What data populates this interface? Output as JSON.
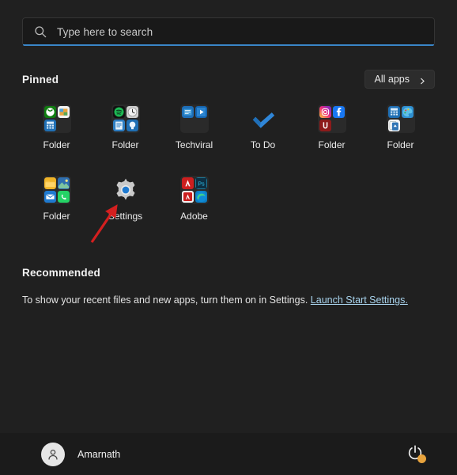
{
  "search": {
    "placeholder": "Type here to search",
    "icon": "search-icon",
    "accent_color": "#3a86c8"
  },
  "pinned": {
    "title": "Pinned",
    "all_apps_label": "All apps",
    "all_apps_icon": "chevron-right-icon",
    "items": [
      {
        "label": "Folder",
        "type": "folder",
        "icons": [
          "xbox-icon",
          "store-icon",
          "calculator-icon"
        ]
      },
      {
        "label": "Folder",
        "type": "folder",
        "icons": [
          "spotify-icon",
          "clock-icon",
          "notepad-icon",
          "tips-icon"
        ]
      },
      {
        "label": "Techviral",
        "type": "folder",
        "icons": [
          "news-icon",
          "video-icon"
        ]
      },
      {
        "label": "To Do",
        "type": "app",
        "icon": "todo-checkmark-icon"
      },
      {
        "label": "Folder",
        "type": "folder",
        "icons": [
          "instagram-icon",
          "facebook-icon",
          "uc-browser-icon"
        ]
      },
      {
        "label": "Folder",
        "type": "folder",
        "icons": [
          "calculator-icon",
          "paint-icon",
          "solitaire-icon"
        ]
      },
      {
        "label": "Folder",
        "type": "folder",
        "icons": [
          "file-explorer-icon",
          "photos-icon",
          "mail-icon",
          "whatsapp-icon"
        ]
      },
      {
        "label": "Settings",
        "type": "app",
        "icon": "gear-icon"
      },
      {
        "label": "Adobe",
        "type": "folder",
        "icons": [
          "acrobat-icon",
          "photoshop-icon",
          "adobe-red-icon",
          "edge-icon"
        ]
      }
    ]
  },
  "recommended": {
    "title": "Recommended",
    "message": "To show your recent files and new apps, turn them on in Settings.",
    "link_label": "Launch Start Settings."
  },
  "footer": {
    "user_name": "Amarnath",
    "avatar_icon": "user-avatar-icon",
    "power_icon": "power-icon",
    "power_badge_color": "#e8a33d"
  },
  "annotation": {
    "arrow_color": "#d31f1f",
    "points_to": "Settings"
  }
}
